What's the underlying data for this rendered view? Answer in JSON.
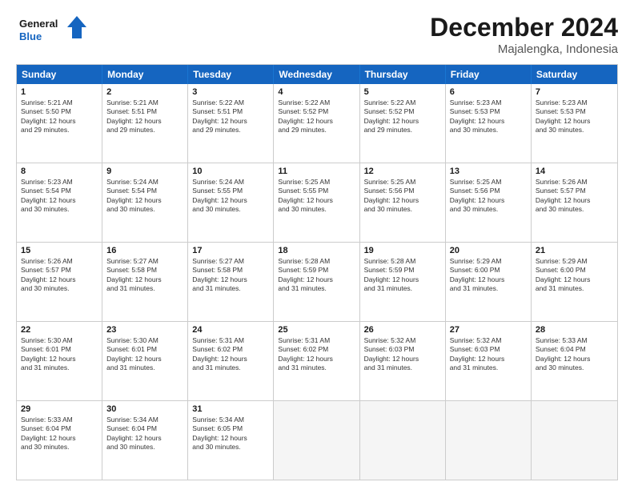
{
  "header": {
    "logo_line1": "General",
    "logo_line2": "Blue",
    "title": "December 2024",
    "subtitle": "Majalengka, Indonesia"
  },
  "days_of_week": [
    "Sunday",
    "Monday",
    "Tuesday",
    "Wednesday",
    "Thursday",
    "Friday",
    "Saturday"
  ],
  "weeks": [
    [
      {
        "day": "1",
        "info": "Sunrise: 5:21 AM\nSunset: 5:50 PM\nDaylight: 12 hours\nand 29 minutes."
      },
      {
        "day": "2",
        "info": "Sunrise: 5:21 AM\nSunset: 5:51 PM\nDaylight: 12 hours\nand 29 minutes."
      },
      {
        "day": "3",
        "info": "Sunrise: 5:22 AM\nSunset: 5:51 PM\nDaylight: 12 hours\nand 29 minutes."
      },
      {
        "day": "4",
        "info": "Sunrise: 5:22 AM\nSunset: 5:52 PM\nDaylight: 12 hours\nand 29 minutes."
      },
      {
        "day": "5",
        "info": "Sunrise: 5:22 AM\nSunset: 5:52 PM\nDaylight: 12 hours\nand 29 minutes."
      },
      {
        "day": "6",
        "info": "Sunrise: 5:23 AM\nSunset: 5:53 PM\nDaylight: 12 hours\nand 30 minutes."
      },
      {
        "day": "7",
        "info": "Sunrise: 5:23 AM\nSunset: 5:53 PM\nDaylight: 12 hours\nand 30 minutes."
      }
    ],
    [
      {
        "day": "8",
        "info": "Sunrise: 5:23 AM\nSunset: 5:54 PM\nDaylight: 12 hours\nand 30 minutes."
      },
      {
        "day": "9",
        "info": "Sunrise: 5:24 AM\nSunset: 5:54 PM\nDaylight: 12 hours\nand 30 minutes."
      },
      {
        "day": "10",
        "info": "Sunrise: 5:24 AM\nSunset: 5:55 PM\nDaylight: 12 hours\nand 30 minutes."
      },
      {
        "day": "11",
        "info": "Sunrise: 5:25 AM\nSunset: 5:55 PM\nDaylight: 12 hours\nand 30 minutes."
      },
      {
        "day": "12",
        "info": "Sunrise: 5:25 AM\nSunset: 5:56 PM\nDaylight: 12 hours\nand 30 minutes."
      },
      {
        "day": "13",
        "info": "Sunrise: 5:25 AM\nSunset: 5:56 PM\nDaylight: 12 hours\nand 30 minutes."
      },
      {
        "day": "14",
        "info": "Sunrise: 5:26 AM\nSunset: 5:57 PM\nDaylight: 12 hours\nand 30 minutes."
      }
    ],
    [
      {
        "day": "15",
        "info": "Sunrise: 5:26 AM\nSunset: 5:57 PM\nDaylight: 12 hours\nand 30 minutes."
      },
      {
        "day": "16",
        "info": "Sunrise: 5:27 AM\nSunset: 5:58 PM\nDaylight: 12 hours\nand 31 minutes."
      },
      {
        "day": "17",
        "info": "Sunrise: 5:27 AM\nSunset: 5:58 PM\nDaylight: 12 hours\nand 31 minutes."
      },
      {
        "day": "18",
        "info": "Sunrise: 5:28 AM\nSunset: 5:59 PM\nDaylight: 12 hours\nand 31 minutes."
      },
      {
        "day": "19",
        "info": "Sunrise: 5:28 AM\nSunset: 5:59 PM\nDaylight: 12 hours\nand 31 minutes."
      },
      {
        "day": "20",
        "info": "Sunrise: 5:29 AM\nSunset: 6:00 PM\nDaylight: 12 hours\nand 31 minutes."
      },
      {
        "day": "21",
        "info": "Sunrise: 5:29 AM\nSunset: 6:00 PM\nDaylight: 12 hours\nand 31 minutes."
      }
    ],
    [
      {
        "day": "22",
        "info": "Sunrise: 5:30 AM\nSunset: 6:01 PM\nDaylight: 12 hours\nand 31 minutes."
      },
      {
        "day": "23",
        "info": "Sunrise: 5:30 AM\nSunset: 6:01 PM\nDaylight: 12 hours\nand 31 minutes."
      },
      {
        "day": "24",
        "info": "Sunrise: 5:31 AM\nSunset: 6:02 PM\nDaylight: 12 hours\nand 31 minutes."
      },
      {
        "day": "25",
        "info": "Sunrise: 5:31 AM\nSunset: 6:02 PM\nDaylight: 12 hours\nand 31 minutes."
      },
      {
        "day": "26",
        "info": "Sunrise: 5:32 AM\nSunset: 6:03 PM\nDaylight: 12 hours\nand 31 minutes."
      },
      {
        "day": "27",
        "info": "Sunrise: 5:32 AM\nSunset: 6:03 PM\nDaylight: 12 hours\nand 31 minutes."
      },
      {
        "day": "28",
        "info": "Sunrise: 5:33 AM\nSunset: 6:04 PM\nDaylight: 12 hours\nand 30 minutes."
      }
    ],
    [
      {
        "day": "29",
        "info": "Sunrise: 5:33 AM\nSunset: 6:04 PM\nDaylight: 12 hours\nand 30 minutes."
      },
      {
        "day": "30",
        "info": "Sunrise: 5:34 AM\nSunset: 6:04 PM\nDaylight: 12 hours\nand 30 minutes."
      },
      {
        "day": "31",
        "info": "Sunrise: 5:34 AM\nSunset: 6:05 PM\nDaylight: 12 hours\nand 30 minutes."
      },
      {
        "day": "",
        "info": ""
      },
      {
        "day": "",
        "info": ""
      },
      {
        "day": "",
        "info": ""
      },
      {
        "day": "",
        "info": ""
      }
    ]
  ]
}
